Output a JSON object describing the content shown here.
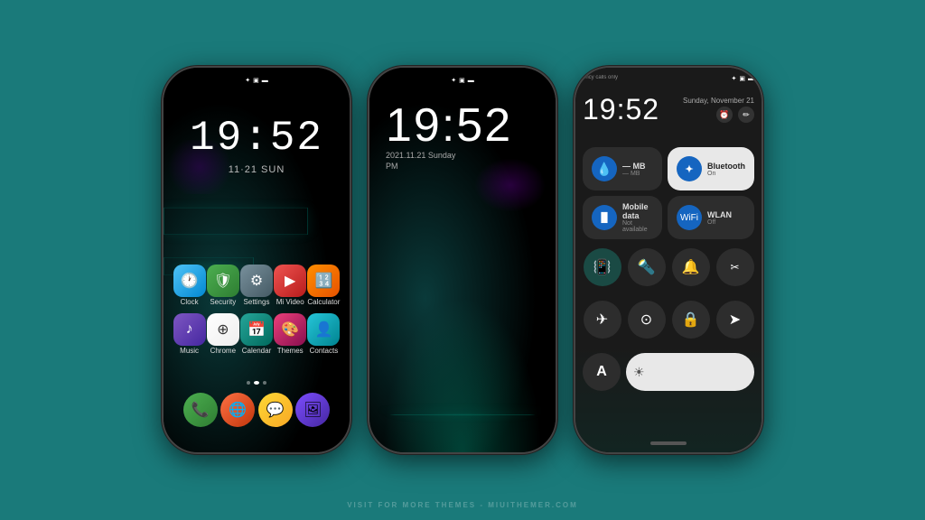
{
  "background": "#1a7a7a",
  "watermark": "VISIT FOR MORE THEMES - MIUITHEMER.COM",
  "phone1": {
    "time": "19:52",
    "date": "11·21  SUN",
    "status_icons": "✦ ☐ 🔋",
    "apps_row1": [
      {
        "name": "Clock",
        "icon": "🕐",
        "class": "icon-clock"
      },
      {
        "name": "Security",
        "icon": "🛡",
        "class": "icon-security"
      },
      {
        "name": "Settings",
        "icon": "⚙",
        "class": "icon-settings"
      },
      {
        "name": "Mi Video",
        "icon": "▶",
        "class": "icon-mivideo"
      },
      {
        "name": "Calculator",
        "icon": "🔢",
        "class": "icon-calculator"
      }
    ],
    "apps_row2": [
      {
        "name": "Music",
        "icon": "♪",
        "class": "icon-music"
      },
      {
        "name": "Chrome",
        "icon": "⊕",
        "class": "icon-chrome"
      },
      {
        "name": "Calendar",
        "icon": "📅",
        "class": "icon-calendar"
      },
      {
        "name": "Themes",
        "icon": "🎨",
        "class": "icon-themes"
      },
      {
        "name": "Contacts",
        "icon": "👤",
        "class": "icon-contacts"
      }
    ],
    "dock": [
      {
        "icon": "📞",
        "class": "icon-phone"
      },
      {
        "icon": "🌐",
        "class": "icon-browser"
      },
      {
        "icon": "💬",
        "class": "icon-messages"
      },
      {
        "icon": "🖼",
        "class": "icon-gallery"
      }
    ]
  },
  "phone2": {
    "time": "19:52",
    "date": "2021.11.21 Sunday",
    "period": "PM",
    "status_icons": "✦ ☐ 🔋"
  },
  "phone3": {
    "emergency_text": "ency calls only",
    "time": "19:52",
    "date": "Sunday, November 21",
    "status_icons": "✦ ☐ 🔋",
    "tiles": [
      {
        "name": "— MB",
        "sub": "— MB",
        "icon": "💧",
        "icon_class": "tile-icon-blue",
        "bg": "tile-dark",
        "name_class": "tile-name",
        "sub_class": "tile-sub"
      },
      {
        "name": "Bluetooth",
        "sub": "On",
        "icon": "✦",
        "icon_class": "tile-icon-bt",
        "bg": "tile-light",
        "name_class": "tile-name-dark",
        "sub_class": "tile-sub-dark"
      },
      {
        "name": "Mobile data",
        "sub": "Not available",
        "icon": "📶",
        "icon_class": "tile-icon-blue",
        "bg": "tile-dark",
        "name_class": "tile-name",
        "sub_class": "tile-sub"
      },
      {
        "name": "WLAN",
        "sub": "Off",
        "icon": "📶",
        "icon_class": "tile-icon-blue",
        "bg": "tile-dark",
        "name_class": "tile-name",
        "sub_class": "tile-sub"
      }
    ],
    "quick_actions_row1": [
      {
        "icon": "📳",
        "teal": true
      },
      {
        "icon": "🔦",
        "teal": false
      },
      {
        "icon": "🔔",
        "teal": false
      },
      {
        "icon": "✂",
        "teal": false
      }
    ],
    "quick_actions_row2": [
      {
        "icon": "✈",
        "teal": false
      },
      {
        "icon": "⊙",
        "teal": false
      },
      {
        "icon": "🔒",
        "teal": false
      },
      {
        "icon": "➤",
        "teal": false
      }
    ],
    "brightness_letter": "A",
    "brightness_icon": "☀"
  }
}
